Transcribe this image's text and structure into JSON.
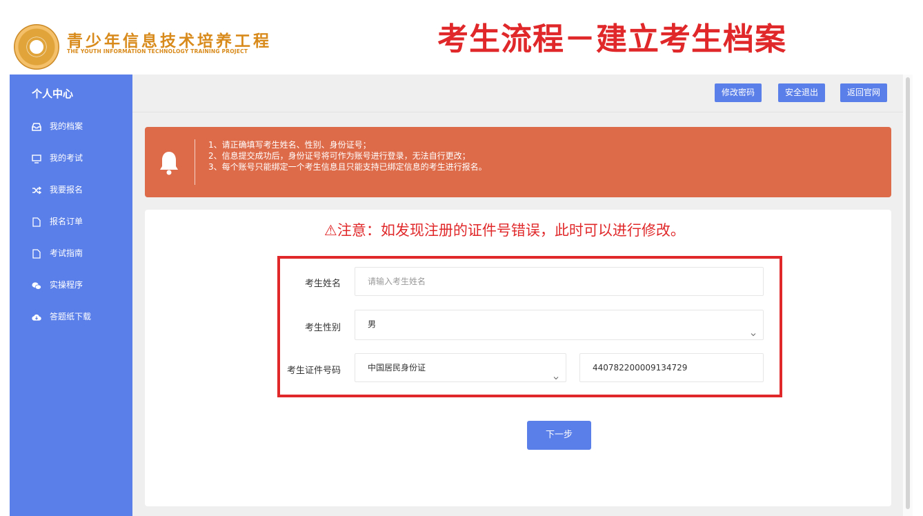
{
  "brand": {
    "name_cn": "青少年信息技术培养工程",
    "name_en": "THE YOUTH INFORMATION TECHNOLOGY TRAINING PROJECT"
  },
  "page_heading": "考生流程－建立考生档案",
  "sidebar": {
    "title": "个人中心",
    "items": [
      {
        "label": "我的档案",
        "icon": "inbox-icon"
      },
      {
        "label": "我的考试",
        "icon": "monitor-icon"
      },
      {
        "label": "我要报名",
        "icon": "shuffle-icon"
      },
      {
        "label": "报名订单",
        "icon": "file-icon"
      },
      {
        "label": "考试指南",
        "icon": "file-icon"
      },
      {
        "label": "实操程序",
        "icon": "wechat-icon"
      },
      {
        "label": "答题纸下载",
        "icon": "cloud-download-icon"
      }
    ]
  },
  "topbar": {
    "buttons": [
      "修改密码",
      "安全退出",
      "返回官网"
    ]
  },
  "alert": {
    "icon": "bell-icon",
    "lines": [
      "1、请正确填写考生姓名、性别、身份证号；",
      "2、信息提交成功后，身份证号将可作为账号进行登录，无法自行更改；",
      "3、每个账号只能绑定一个考生信息且只能支持已绑定信息的考生进行报名。"
    ]
  },
  "notice": "⚠注意：如发现注册的证件号错误，此时可以进行修改。",
  "form": {
    "name": {
      "label": "考生姓名",
      "placeholder": "请输入考生姓名"
    },
    "gender": {
      "label": "考生性别",
      "value": "男"
    },
    "id": {
      "label": "考生证件号码",
      "type_value": "中国居民身份证",
      "number_value": "440782200009134729"
    }
  },
  "next_button": "下一步",
  "colors": {
    "sidebar": "#5b7fe8",
    "alert": "#dd6b4a",
    "heading": "#e0282a",
    "brand": "#d88a1a"
  }
}
